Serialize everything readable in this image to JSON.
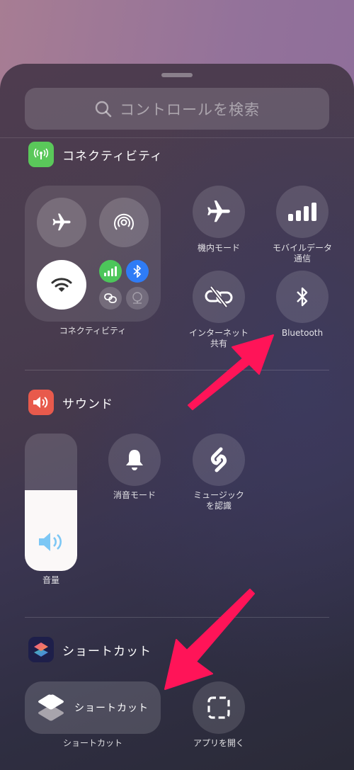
{
  "search": {
    "placeholder": "コントロールを検索",
    "icon": "search-icon"
  },
  "sections": {
    "connectivity": {
      "title": "コネクティビティ",
      "icon": "antenna-icon",
      "icon_color": "#5ac85a",
      "group": {
        "label": "コネクティビティ",
        "toggles": [
          {
            "name": "airplane-mode",
            "icon": "airplane-icon",
            "active": false
          },
          {
            "name": "airdrop",
            "icon": "airdrop-icon",
            "active": false
          },
          {
            "name": "wifi",
            "icon": "wifi-icon",
            "active": true
          },
          {
            "name": "cellular",
            "icon": "cellular-icon",
            "active": true,
            "color": "#4cc65a"
          },
          {
            "name": "bluetooth",
            "icon": "bluetooth-icon",
            "active": true,
            "color": "#2f7cf6"
          },
          {
            "name": "hotspot",
            "icon": "link-icon",
            "active": false
          },
          {
            "name": "vpn",
            "icon": "globe-network-icon",
            "active": false
          }
        ]
      },
      "controls": [
        {
          "label": "機内モード",
          "icon": "airplane-icon"
        },
        {
          "label": "モバイルデータ\n通信",
          "icon": "cellular-icon"
        },
        {
          "label": "インターネット\n共有",
          "icon": "link-slash-icon"
        },
        {
          "label": "Bluetooth",
          "icon": "bluetooth-icon"
        }
      ]
    },
    "sound": {
      "title": "サウンド",
      "icon": "speaker-icon",
      "icon_color": "#e85a4c",
      "volume": {
        "label": "音量",
        "level_percent": 59
      },
      "controls": [
        {
          "label": "消音モード",
          "icon": "bell-icon"
        },
        {
          "label": "ミュージック\nを認識",
          "icon": "shazam-icon"
        }
      ]
    },
    "shortcuts": {
      "title": "ショートカット",
      "icon": "shortcuts-app-icon",
      "controls": [
        {
          "label": "ショートカット",
          "pill_text": "ショートカット",
          "icon": "shortcuts-layers-icon"
        },
        {
          "label": "アプリを開く",
          "icon": "dashed-square-icon"
        }
      ]
    }
  },
  "annotations": {
    "arrow_color": "#ff1458"
  }
}
